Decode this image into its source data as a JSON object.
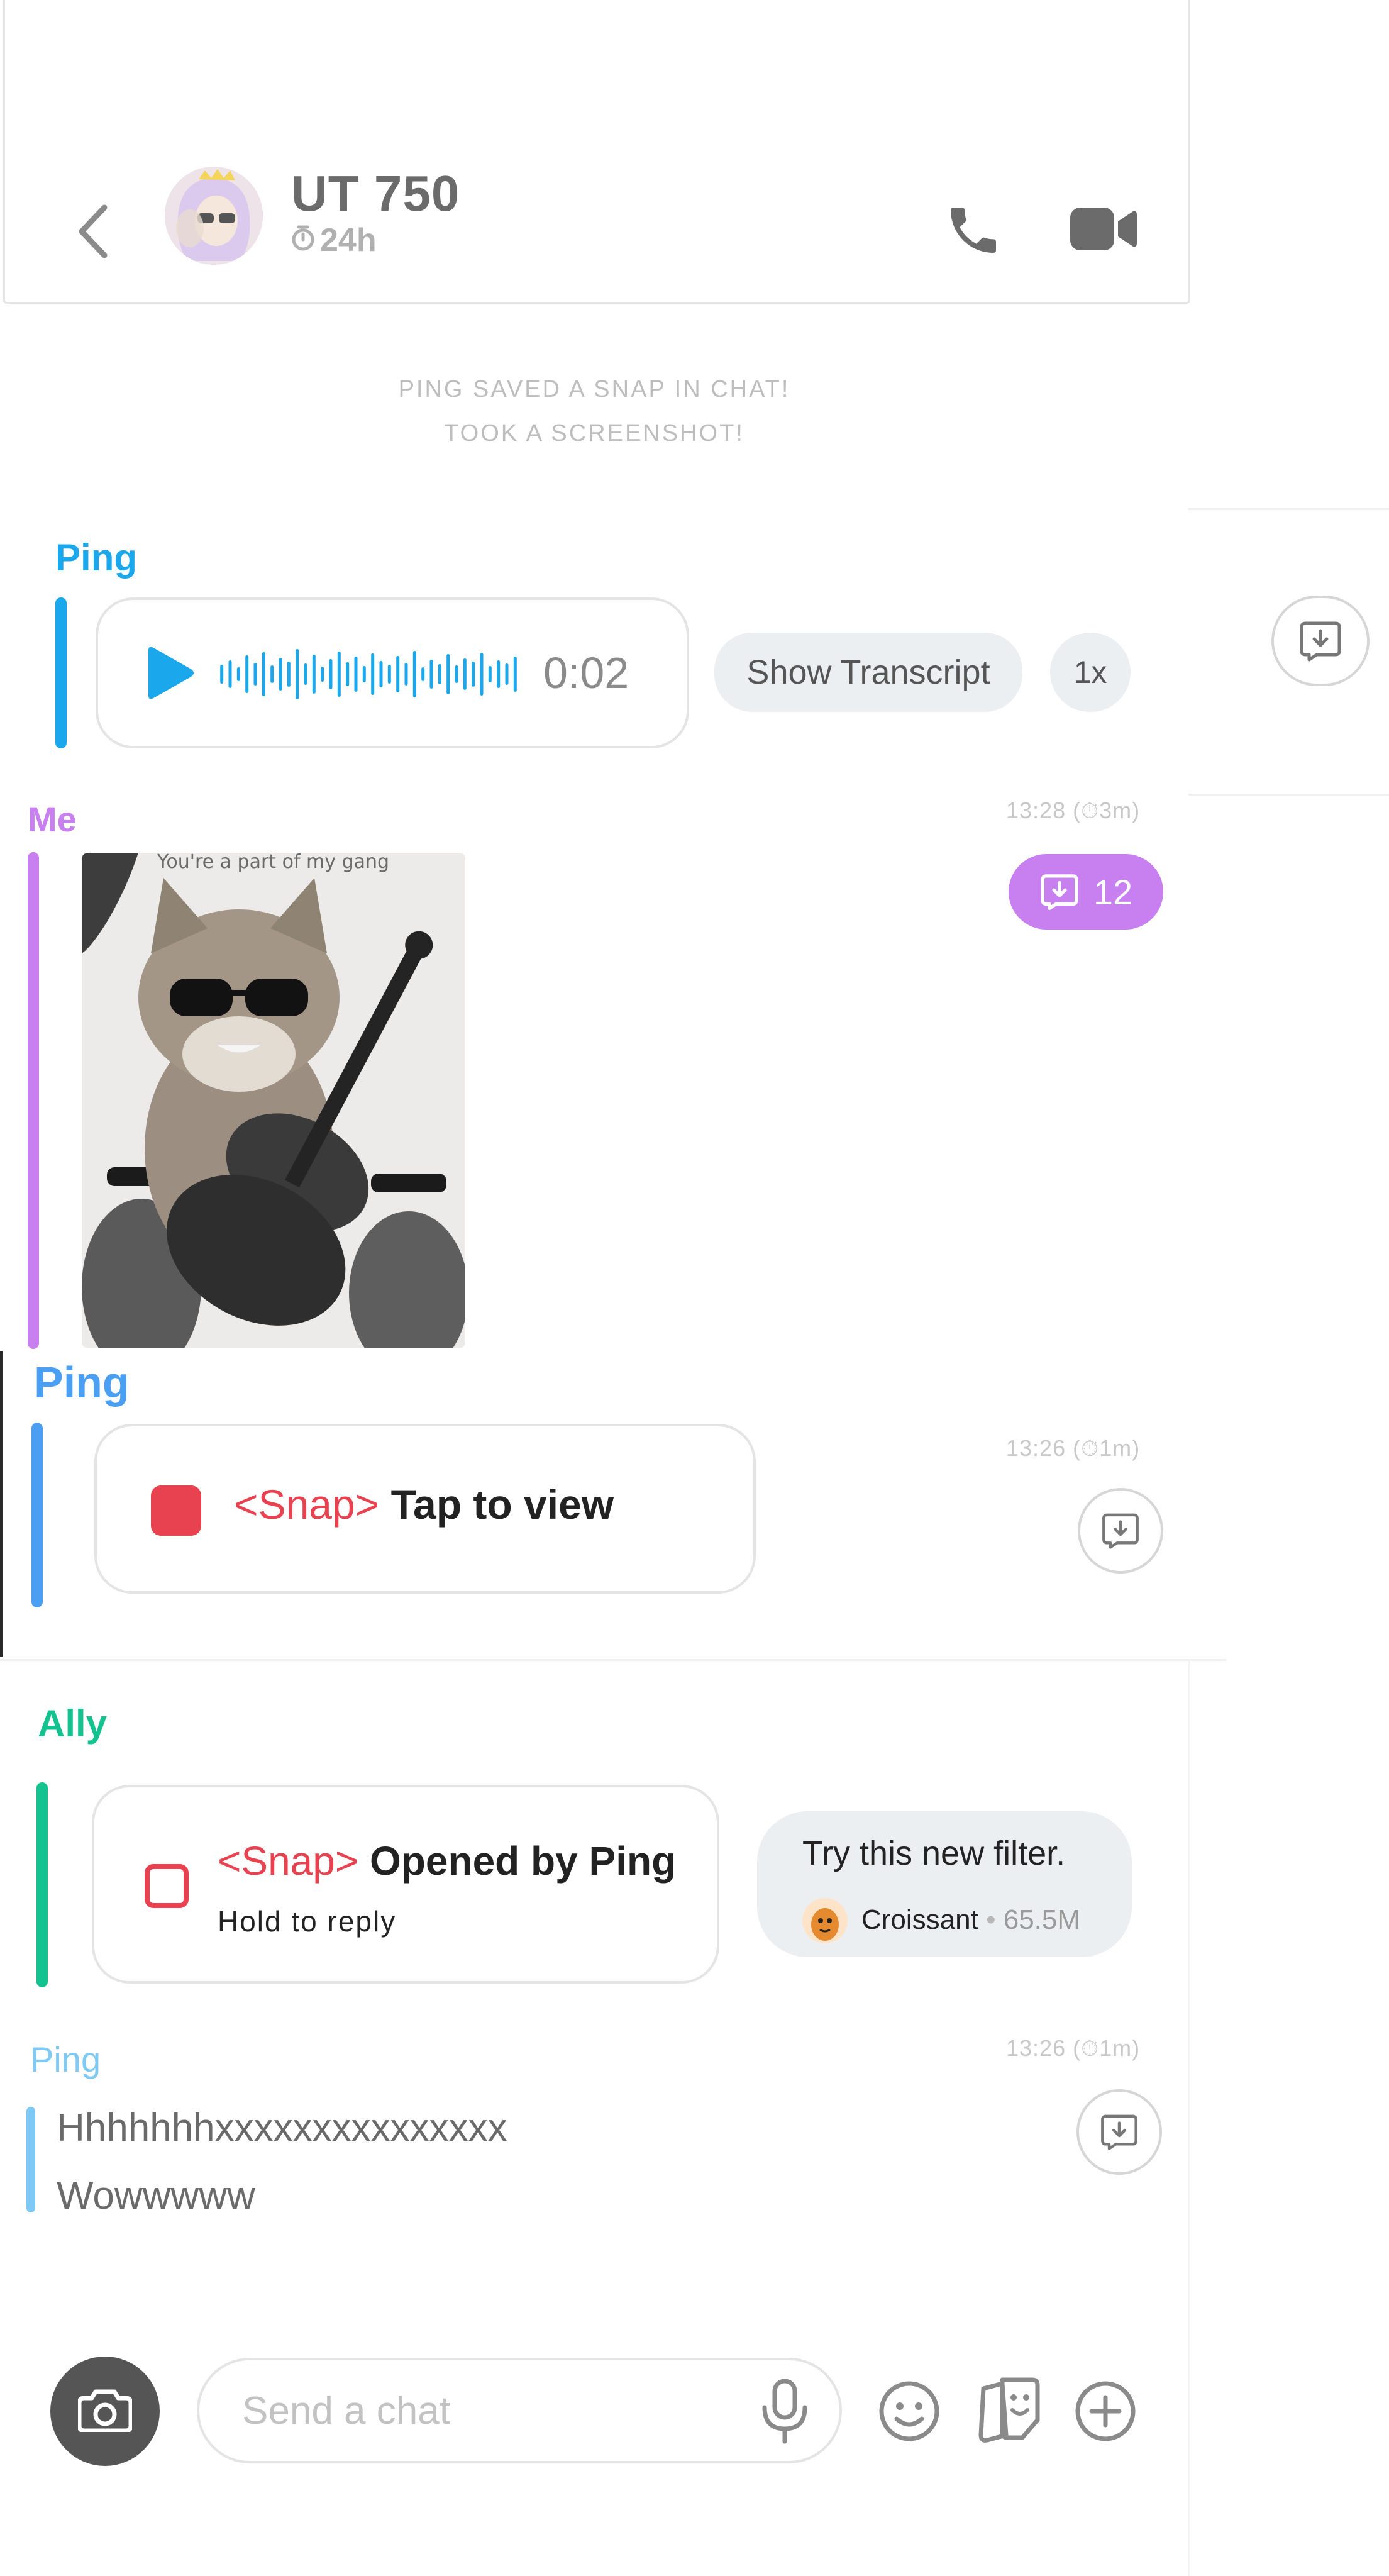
{
  "header": {
    "title": "UT 750",
    "timer": "24h",
    "icons": [
      "back-arrow-icon",
      "avatar",
      "timer-icon",
      "phone-icon",
      "video-camera-icon"
    ]
  },
  "system_messages": [
    "PING SAVED A SNAP IN CHAT!",
    "TOOK A SCREENSHOT!"
  ],
  "messages": {
    "voice": {
      "sender": "Ping",
      "duration": "0:02",
      "transcript_button": "Show Transcript",
      "speed": "1x"
    },
    "image": {
      "sender": "Me",
      "timestamp": "13:28 (⏱3m)",
      "caption": "You're a part of my gang",
      "saved_count": "12"
    },
    "snap_unopened": {
      "sender": "Ping",
      "timestamp": "13:26 (⏱1m)",
      "snap_tag": "<Snap>",
      "label": "Tap to view"
    },
    "snap_opened": {
      "sender": "Ally",
      "snap_tag": "<Snap>",
      "label": "Opened by Ping",
      "hint": "Hold to reply",
      "filter_text": "Try this new filter.",
      "filter_name": "Croissant",
      "filter_count": "65.5M"
    },
    "text": {
      "sender": "Ping",
      "timestamp": "13:26 (⏱1m)",
      "lines": [
        "Hhhhhhhxxxxxxxxxxxxxxx",
        "Wowwwww"
      ]
    }
  },
  "composer": {
    "placeholder": "Send a chat"
  },
  "colors": {
    "ping": "#1aa7ec",
    "me": "#c87ff0",
    "ally": "#14c28f",
    "snap_red": "#e8414f",
    "save_badge": "#c87ff0"
  }
}
